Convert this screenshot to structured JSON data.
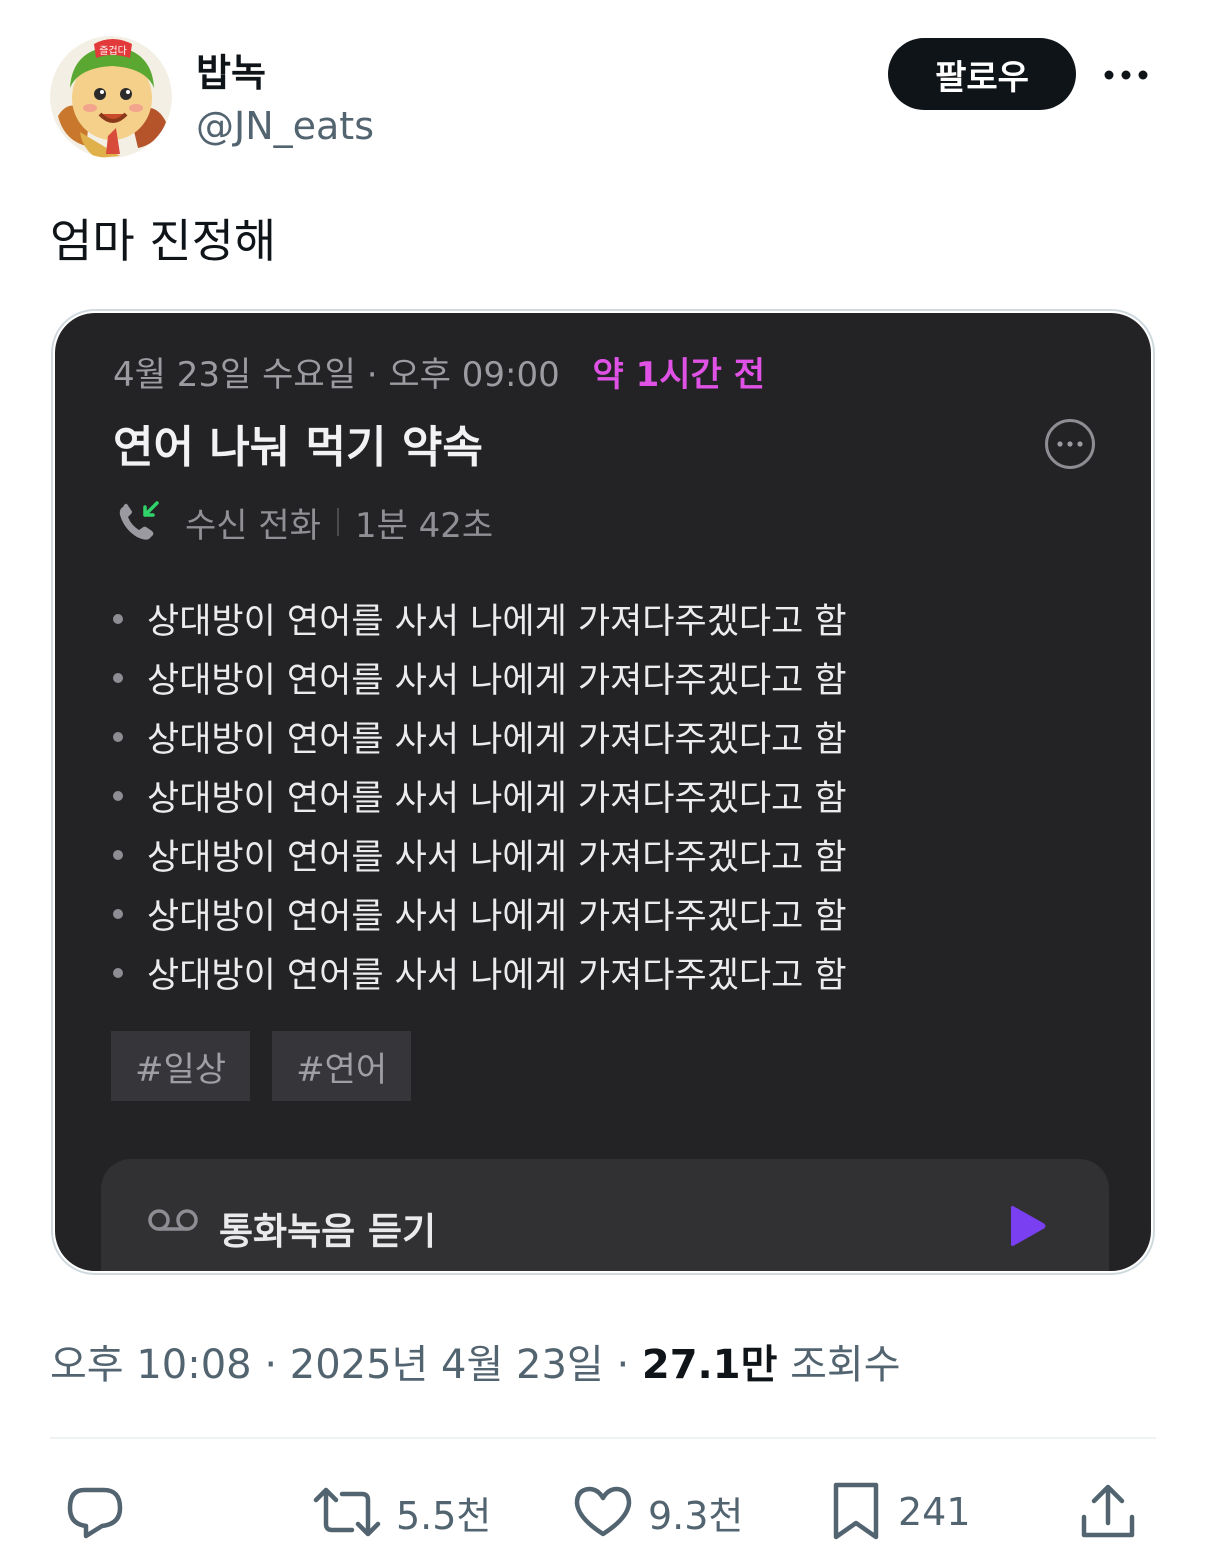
{
  "author": {
    "name": "밥녹",
    "handle": "@JN_eats",
    "avatar_badge": "즐겁다",
    "follow_label": "팔로우"
  },
  "tweet": {
    "text": "엄마 진정해"
  },
  "card": {
    "date": "4월 23일 수요일",
    "time": "오후 09:00",
    "relative": "약 1시간 전",
    "title": "연어 나눠 먹기 약속",
    "call_type": "수신 전화",
    "call_duration": "1분 42초",
    "bullets": [
      "상대방이 연어를 사서 나에게 가져다주겠다고 함",
      "상대방이 연어를 사서 나에게 가져다주겠다고 함",
      "상대방이 연어를 사서 나에게 가져다주겠다고 함",
      "상대방이 연어를 사서 나에게 가져다주겠다고 함",
      "상대방이 연어를 사서 나에게 가져다주겠다고 함",
      "상대방이 연어를 사서 나에게 가져다주겠다고 함",
      "상대방이 연어를 사서 나에게 가져다주겠다고 함"
    ],
    "tags": [
      "#일상",
      "#연어"
    ],
    "listen_label": "통화녹음 듣기",
    "accent_color": "#e052e6",
    "play_color": "#7b3ff2"
  },
  "meta": {
    "time": "오후 10:08",
    "date": "2025년 4월 23일",
    "views_count": "27.1만",
    "views_label": "조회수"
  },
  "actions": {
    "reply_icon": "reply-icon",
    "retweets": "5.5천",
    "likes": "9.3천",
    "bookmarks": "241",
    "share_icon": "share-icon"
  }
}
